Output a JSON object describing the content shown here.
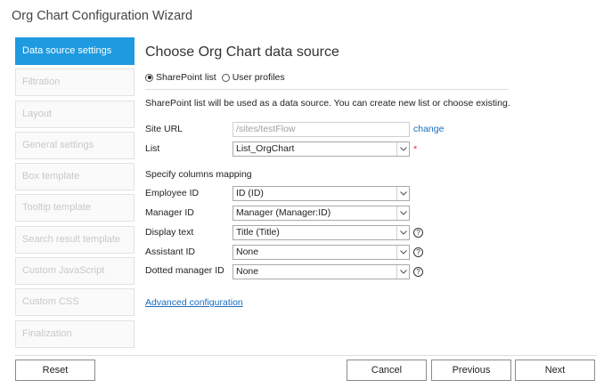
{
  "window": {
    "title": "Org Chart Configuration Wizard"
  },
  "sidebar": {
    "steps": [
      {
        "label": "Data source settings"
      },
      {
        "label": "Filtration"
      },
      {
        "label": "Layout"
      },
      {
        "label": "General settings"
      },
      {
        "label": "Box template"
      },
      {
        "label": "Tooltip template"
      },
      {
        "label": "Search result template"
      },
      {
        "label": "Custom JavaScript"
      },
      {
        "label": "Custom CSS"
      },
      {
        "label": "Finalization"
      }
    ]
  },
  "main": {
    "heading": "Choose Org Chart data source",
    "source_options": {
      "sharepoint": "SharePoint list",
      "user_profiles": "User profiles",
      "selected": "SharePoint list"
    },
    "description": "SharePoint list will be used as a data source. You can create new list or choose existing.",
    "site_url": {
      "label": "Site URL",
      "value": "/sites/testFlow",
      "change_link": "change"
    },
    "list": {
      "label": "List",
      "value": "List_OrgChart",
      "required_mark": "*"
    },
    "mapping_title": "Specify columns mapping",
    "mappings": {
      "employee_id": {
        "label": "Employee ID",
        "value": "ID (ID)"
      },
      "manager_id": {
        "label": "Manager ID",
        "value": "Manager (Manager:ID)"
      },
      "display_text": {
        "label": "Display text",
        "value": "Title (Title)",
        "help": "?"
      },
      "assistant_id": {
        "label": "Assistant ID",
        "value": "None",
        "help": "?"
      },
      "dotted_manager_id": {
        "label": "Dotted manager ID",
        "value": "None",
        "help": "?"
      }
    },
    "advanced_link": "Advanced configuration"
  },
  "footer": {
    "reset": "Reset",
    "cancel": "Cancel",
    "previous": "Previous",
    "next": "Next"
  },
  "colors": {
    "accent": "#1e9be0",
    "link": "#1a6dbf",
    "required": "#e04040"
  }
}
